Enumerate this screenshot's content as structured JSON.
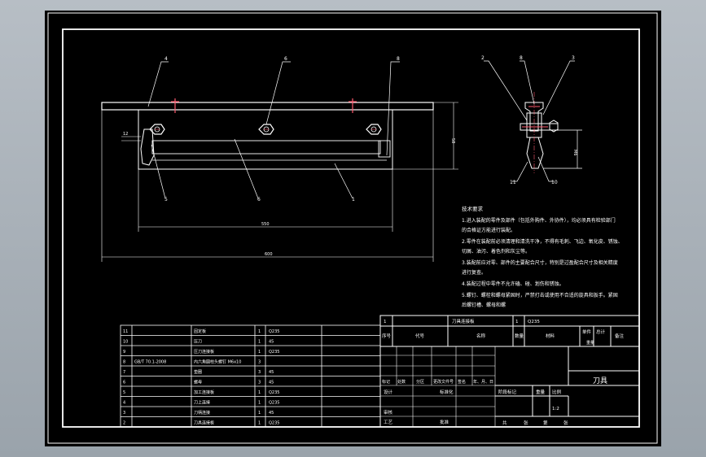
{
  "drawing": {
    "dimensions": {
      "length_small": "550",
      "length_total": "600",
      "height": "58",
      "hole": "M6",
      "side": "12"
    },
    "balloons_front": [
      "4",
      "6",
      "8",
      "5",
      "6",
      "1"
    ],
    "balloons_side": [
      "2",
      "8",
      "3",
      "11",
      "10"
    ],
    "tech_title": "技术要求",
    "tech_lines": [
      "1.进入装配的零件及部件（包括外购件、外协件），均必须具有检验部门",
      "的合格证方能进行装配。",
      "2.零件在装配前必须清理和清洗干净，不得有毛刺、飞边、氧化皮、锈蚀、",
      "切屑、油污、着色剂和灰尘等。",
      "3.装配前应对零、部件的主要配合尺寸，特别是过盈配合尺寸及相关精度",
      "进行复查。",
      "4.装配过程中零件不允许磕、碰、划伤和锈蚀。",
      "5.螺钉、螺栓和螺母紧固时，严禁打击或使用不合适的旋具和扳手。紧固",
      "后螺钉槽、螺母和螺"
    ]
  },
  "parts_list": [
    {
      "no": "11",
      "code": "",
      "name": "固定板",
      "qty": "1",
      "mat": "Q235"
    },
    {
      "no": "10",
      "code": "",
      "name": "压刀",
      "qty": "1",
      "mat": "45"
    },
    {
      "no": "9",
      "code": "",
      "name": "压刀连接板",
      "qty": "1",
      "mat": "Q235"
    },
    {
      "no": "8",
      "code": "GB/T 70.1-2008",
      "name": "内六角圆柱头螺钉 M6x10",
      "qty": "3",
      "mat": ""
    },
    {
      "no": "7",
      "code": "",
      "name": "垫圈",
      "qty": "3",
      "mat": "45"
    },
    {
      "no": "6",
      "code": "",
      "name": "螺母",
      "qty": "3",
      "mat": "45"
    },
    {
      "no": "5",
      "code": "",
      "name": "加工连接板",
      "qty": "1",
      "mat": "Q235"
    },
    {
      "no": "4",
      "code": "",
      "name": "刀上连接",
      "qty": "1",
      "mat": "Q235"
    },
    {
      "no": "3",
      "code": "",
      "name": "刀柄连接",
      "qty": "1",
      "mat": "45"
    },
    {
      "no": "2",
      "code": "",
      "name": "刀具连接板",
      "qty": "1",
      "mat": "Q235"
    }
  ],
  "title_block": {
    "row1": {
      "no": "1",
      "name": "刀具连接板",
      "qty": "1",
      "mat": "Q235"
    },
    "header": [
      "序号",
      "代号",
      "名称",
      "数量",
      "材料",
      "单件",
      "总计",
      "备注"
    ],
    "mass": "重量",
    "drawing_name": "刀具",
    "rev_labels": [
      "标记",
      "处数",
      "分区",
      "更改文件号",
      "签名",
      "年、月、日"
    ],
    "design": "设计",
    "standardization": "标准化",
    "stage": "阶段标记",
    "weight": "重量",
    "scale_label": "比例",
    "scale": "1:2",
    "review": "审核",
    "process": "工艺",
    "approve": "批准",
    "sheets": [
      "共",
      "张",
      "第",
      "张"
    ]
  }
}
